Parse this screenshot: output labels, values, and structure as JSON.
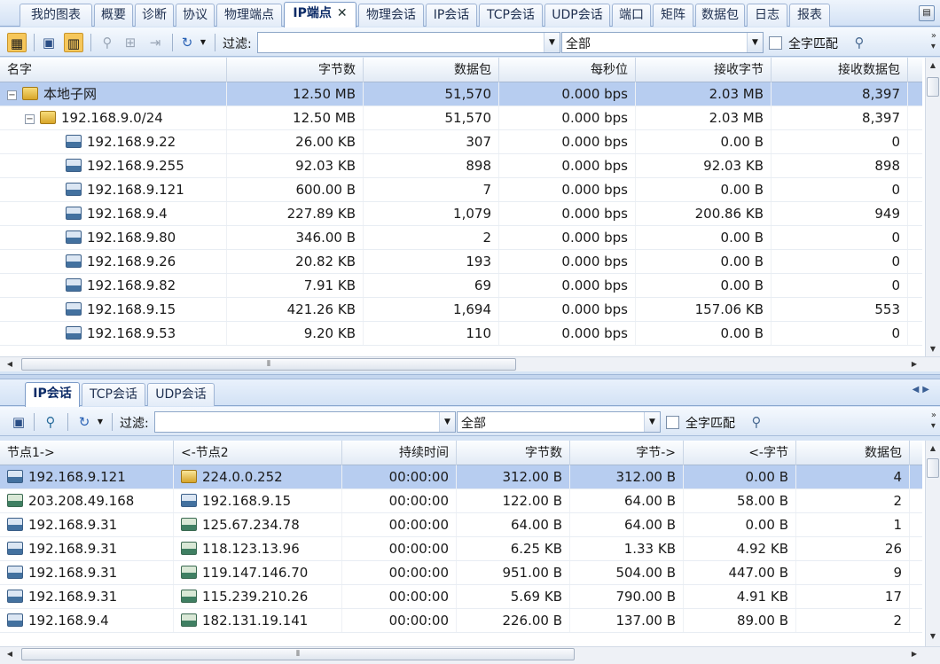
{
  "top_tabs": [
    {
      "label": "我的图表"
    },
    {
      "label": "概要"
    },
    {
      "label": "诊断"
    },
    {
      "label": "协议"
    },
    {
      "label": "物理端点"
    },
    {
      "label": "IP端点",
      "close": "✕"
    },
    {
      "label": "物理会话"
    },
    {
      "label": "IP会话"
    },
    {
      "label": "TCP会话"
    },
    {
      "label": "UDP会话"
    },
    {
      "label": "端口"
    },
    {
      "label": "矩阵"
    },
    {
      "label": "数据包"
    },
    {
      "label": "日志"
    },
    {
      "label": "报表"
    }
  ],
  "top_toolbar": {
    "filter_label": "过滤:",
    "filter_value": "",
    "scope_value": "全部",
    "whole_word_label": "全字匹配"
  },
  "top_grid": {
    "columns": [
      "名字",
      "字节数",
      "数据包",
      "每秒位",
      "接收字节",
      "接收数据包"
    ],
    "rows": [
      {
        "name": "本地子网",
        "bytes": "12.50 MB",
        "packets": "51,570",
        "bps": "0.000 bps",
        "rx_bytes": "2.03 MB",
        "rx_packets": "8,397"
      },
      {
        "name": "192.168.9.0/24",
        "bytes": "12.50 MB",
        "packets": "51,570",
        "bps": "0.000 bps",
        "rx_bytes": "2.03 MB",
        "rx_packets": "8,397"
      },
      {
        "name": "192.168.9.22",
        "bytes": "26.00 KB",
        "packets": "307",
        "bps": "0.000 bps",
        "rx_bytes": "0.00 B",
        "rx_packets": "0"
      },
      {
        "name": "192.168.9.255",
        "bytes": "92.03 KB",
        "packets": "898",
        "bps": "0.000 bps",
        "rx_bytes": "92.03 KB",
        "rx_packets": "898"
      },
      {
        "name": "192.168.9.121",
        "bytes": "600.00 B",
        "packets": "7",
        "bps": "0.000 bps",
        "rx_bytes": "0.00 B",
        "rx_packets": "0"
      },
      {
        "name": "192.168.9.4",
        "bytes": "227.89 KB",
        "packets": "1,079",
        "bps": "0.000 bps",
        "rx_bytes": "200.86 KB",
        "rx_packets": "949"
      },
      {
        "name": "192.168.9.80",
        "bytes": "346.00 B",
        "packets": "2",
        "bps": "0.000 bps",
        "rx_bytes": "0.00 B",
        "rx_packets": "0"
      },
      {
        "name": "192.168.9.26",
        "bytes": "20.82 KB",
        "packets": "193",
        "bps": "0.000 bps",
        "rx_bytes": "0.00 B",
        "rx_packets": "0"
      },
      {
        "name": "192.168.9.82",
        "bytes": "7.91 KB",
        "packets": "69",
        "bps": "0.000 bps",
        "rx_bytes": "0.00 B",
        "rx_packets": "0"
      },
      {
        "name": "192.168.9.15",
        "bytes": "421.26 KB",
        "packets": "1,694",
        "bps": "0.000 bps",
        "rx_bytes": "157.06 KB",
        "rx_packets": "553"
      },
      {
        "name": "192.168.9.53",
        "bytes": "9.20 KB",
        "packets": "110",
        "bps": "0.000 bps",
        "rx_bytes": "0.00 B",
        "rx_packets": "0"
      }
    ]
  },
  "bottom_tabs": [
    {
      "label": "IP会话"
    },
    {
      "label": "TCP会话"
    },
    {
      "label": "UDP会话"
    }
  ],
  "bottom_toolbar": {
    "filter_label": "过滤:",
    "filter_value": "",
    "scope_value": "全部",
    "whole_word_label": "全字匹配"
  },
  "bottom_grid": {
    "columns": [
      "节点1->",
      "<-节点2",
      "持续时间",
      "字节数",
      "字节->",
      "<-字节",
      "数据包"
    ],
    "rows": [
      {
        "node1": "192.168.9.121",
        "node2": "224.0.0.252",
        "duration": "00:00:00",
        "bytes": "312.00 B",
        "bytes_out": "312.00 B",
        "bytes_in": "0.00 B",
        "packets": "4"
      },
      {
        "node1": "203.208.49.168",
        "node2": "192.168.9.15",
        "duration": "00:00:00",
        "bytes": "122.00 B",
        "bytes_out": "64.00 B",
        "bytes_in": "58.00 B",
        "packets": "2"
      },
      {
        "node1": "192.168.9.31",
        "node2": "125.67.234.78",
        "duration": "00:00:00",
        "bytes": "64.00 B",
        "bytes_out": "64.00 B",
        "bytes_in": "0.00 B",
        "packets": "1"
      },
      {
        "node1": "192.168.9.31",
        "node2": "118.123.13.96",
        "duration": "00:00:00",
        "bytes": "6.25 KB",
        "bytes_out": "1.33 KB",
        "bytes_in": "4.92 KB",
        "packets": "26"
      },
      {
        "node1": "192.168.9.31",
        "node2": "119.147.146.70",
        "duration": "00:00:00",
        "bytes": "951.00 B",
        "bytes_out": "504.00 B",
        "bytes_in": "447.00 B",
        "packets": "9"
      },
      {
        "node1": "192.168.9.31",
        "node2": "115.239.210.26",
        "duration": "00:00:00",
        "bytes": "5.69 KB",
        "bytes_out": "790.00 B",
        "bytes_in": "4.91 KB",
        "packets": "17"
      },
      {
        "node1": "192.168.9.4",
        "node2": "182.131.19.141",
        "duration": "00:00:00",
        "bytes": "226.00 B",
        "bytes_out": "137.00 B",
        "bytes_in": "89.00 B",
        "packets": "2"
      }
    ]
  },
  "icons": {
    "refresh": "refresh-icon",
    "save": "save-icon",
    "filter": "filter-icon",
    "search": "search-icon"
  },
  "colors": {
    "selected_row": "#b7cdf0",
    "tab_strip": "#d3e2f5",
    "toolbar": "#dbe7f6"
  }
}
